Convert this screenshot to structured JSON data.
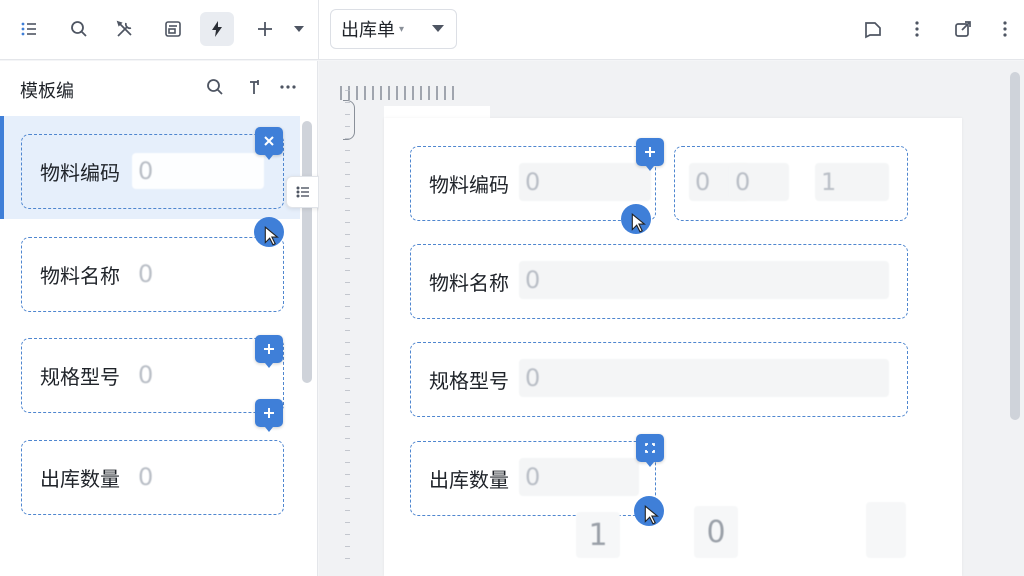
{
  "toolbar": {
    "doc_select_value": "出库单",
    "icons": [
      "list-icon",
      "search-icon",
      "tools-icon",
      "form-icon",
      "lightning-icon",
      "plus-icon",
      "chevron-down-icon",
      "comment-icon",
      "more-vertical-icon",
      "share-icon",
      "more-vertical-icon"
    ]
  },
  "left_panel": {
    "title": "模板编",
    "fields": [
      {
        "label": "物料编码",
        "value": "0"
      },
      {
        "label": "物料名称",
        "value": "0"
      },
      {
        "label": "规格型号",
        "value": "0"
      },
      {
        "label": "出库数量",
        "value": "0"
      }
    ]
  },
  "canvas": {
    "fields": [
      {
        "label": "物料编码",
        "value": "0"
      },
      {
        "label": "物料名称",
        "value": "0"
      },
      {
        "label": "规格型号",
        "value": "0"
      },
      {
        "label": "出库数量",
        "value": "0"
      }
    ],
    "extra_values": [
      "0",
      "0",
      "1"
    ],
    "ghost_values": [
      "1",
      "0"
    ]
  },
  "colors": {
    "accent": "#3f7fd8",
    "dashed_border": "#4f86cf",
    "selected_bg": "#e6effb"
  }
}
